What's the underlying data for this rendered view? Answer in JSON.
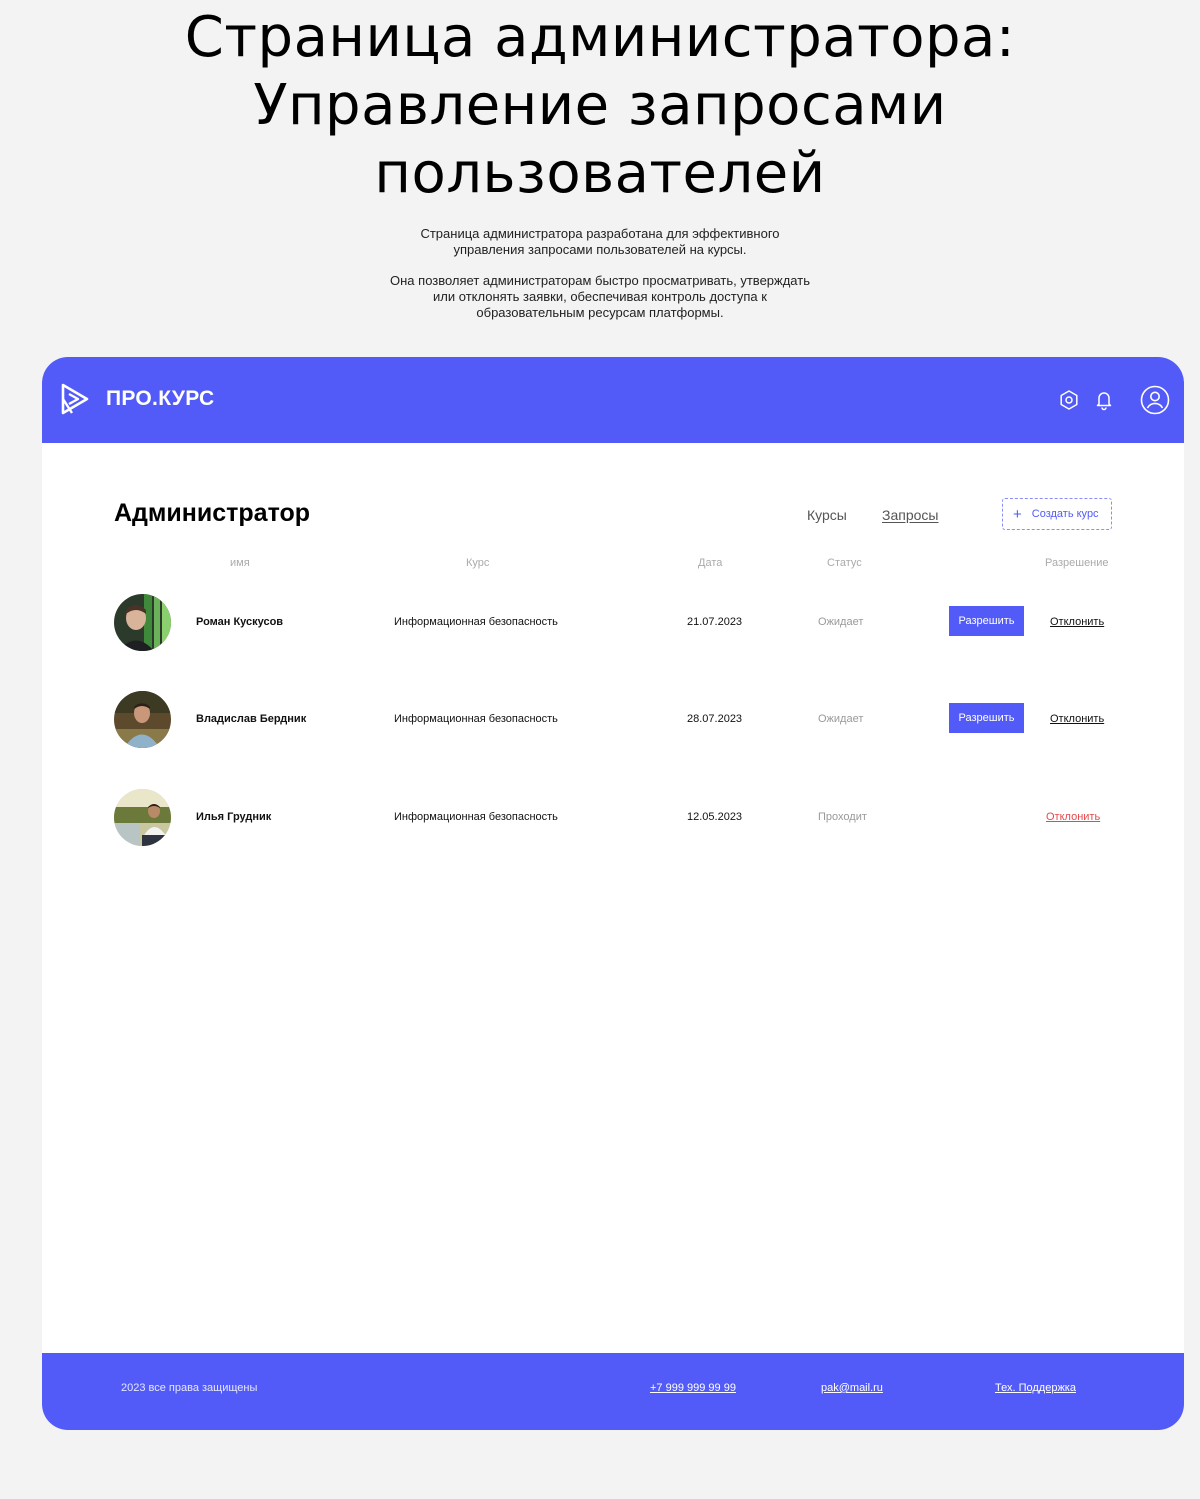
{
  "hero": {
    "title_line1": "Страница администратора:",
    "title_line2": "Управление запросами",
    "title_line3": "пользователей",
    "desc_p1": "Страница администратора разработана для эффективного управления запросами пользователей на курсы.",
    "desc_p2": "Она позволяет администраторам быстро просматривать, утверждать или отклонять заявки, обеспечивая контроль доступа к образовательным ресурсам платформы."
  },
  "header": {
    "logo_text": "ПРО.КУРС",
    "bg_color": "#525bf7",
    "icons": [
      "settings-icon",
      "bell-icon",
      "profile-icon"
    ]
  },
  "page": {
    "title": "Администратор",
    "nav": {
      "courses": "Курсы",
      "requests": "Запросы"
    },
    "create_button": {
      "plus": "+",
      "label": "Создать курс"
    }
  },
  "table": {
    "columns": {
      "name": "имя",
      "course": "Курс",
      "date": "Дата",
      "status": "Статус",
      "permission": "Разрешение"
    },
    "rows": [
      {
        "name": "Роман Кускусов",
        "course": "Информационная безопасность",
        "date": "21.07.2023",
        "status": "Ожидает",
        "approve": "Разрешить",
        "reject": "Отклонить"
      },
      {
        "name": "Владислав Бердник",
        "course": "Информационная безопасность",
        "date": "28.07.2023",
        "status": "Ожидает",
        "approve": "Разрешить",
        "reject": "Отклонить"
      },
      {
        "name": "Илья Грудник",
        "course": "Информационная безопасность",
        "date": "12.05.2023",
        "status": "Проходит",
        "reject": "Отклонить"
      }
    ]
  },
  "footer": {
    "copyright": "2023 все права защищены",
    "phone": "+7 999 999 99 99",
    "email": "pak@mail.ru",
    "support": "Тех. Поддержка"
  },
  "colors": {
    "accent": "#525bf7",
    "danger": "#e5484d"
  }
}
